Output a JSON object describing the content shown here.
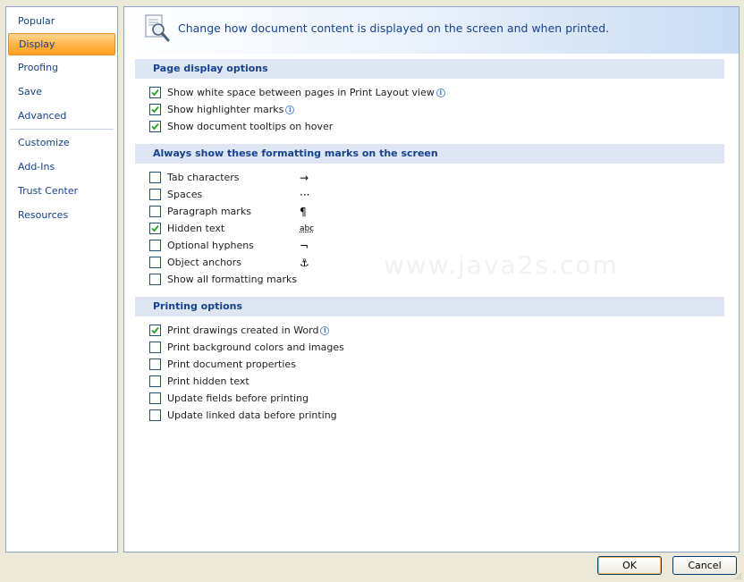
{
  "sidebar": {
    "items": [
      {
        "label": "Popular"
      },
      {
        "label": "Display"
      },
      {
        "label": "Proofing"
      },
      {
        "label": "Save"
      },
      {
        "label": "Advanced"
      },
      {
        "label": "Customize"
      },
      {
        "label": "Add-Ins"
      },
      {
        "label": "Trust Center"
      },
      {
        "label": "Resources"
      }
    ],
    "selected": "Display"
  },
  "banner": {
    "text": "Change how document content is displayed on the screen and when printed.",
    "icon": "document-magnifier-icon"
  },
  "page_display": {
    "title": "Page display options",
    "options": [
      {
        "label": "Show white space between pages in Print Layout view",
        "checked": true,
        "info": true
      },
      {
        "label": "Show highlighter marks",
        "checked": true,
        "info": true
      },
      {
        "label": "Show document tooltips on hover",
        "checked": true,
        "info": false
      }
    ]
  },
  "formatting_marks": {
    "title": "Always show these formatting marks on the screen",
    "options": [
      {
        "label": "Tab characters",
        "checked": false,
        "mark": "→"
      },
      {
        "label": "Spaces",
        "checked": false,
        "mark": "···"
      },
      {
        "label": "Paragraph marks",
        "checked": false,
        "mark": "¶"
      },
      {
        "label": "Hidden text",
        "checked": true,
        "mark": "abc"
      },
      {
        "label": "Optional hyphens",
        "checked": false,
        "mark": "¬"
      },
      {
        "label": "Object anchors",
        "checked": false,
        "mark": "⚓"
      },
      {
        "label": "Show all formatting marks",
        "checked": false,
        "mark": ""
      }
    ]
  },
  "printing": {
    "title": "Printing options",
    "options": [
      {
        "label": "Print drawings created in Word",
        "checked": true,
        "info": true
      },
      {
        "label": "Print background colors and images",
        "checked": false,
        "info": false
      },
      {
        "label": "Print document properties",
        "checked": false,
        "info": false
      },
      {
        "label": "Print hidden text",
        "checked": false,
        "info": false
      },
      {
        "label": "Update fields before printing",
        "checked": false,
        "info": false
      },
      {
        "label": "Update linked data before printing",
        "checked": false,
        "info": false
      }
    ]
  },
  "buttons": {
    "ok": "OK",
    "cancel": "Cancel"
  },
  "watermark": "www.java2s.com",
  "colors": {
    "accent": "#15428b",
    "selected": "#ffb248",
    "check": "#21a121"
  }
}
